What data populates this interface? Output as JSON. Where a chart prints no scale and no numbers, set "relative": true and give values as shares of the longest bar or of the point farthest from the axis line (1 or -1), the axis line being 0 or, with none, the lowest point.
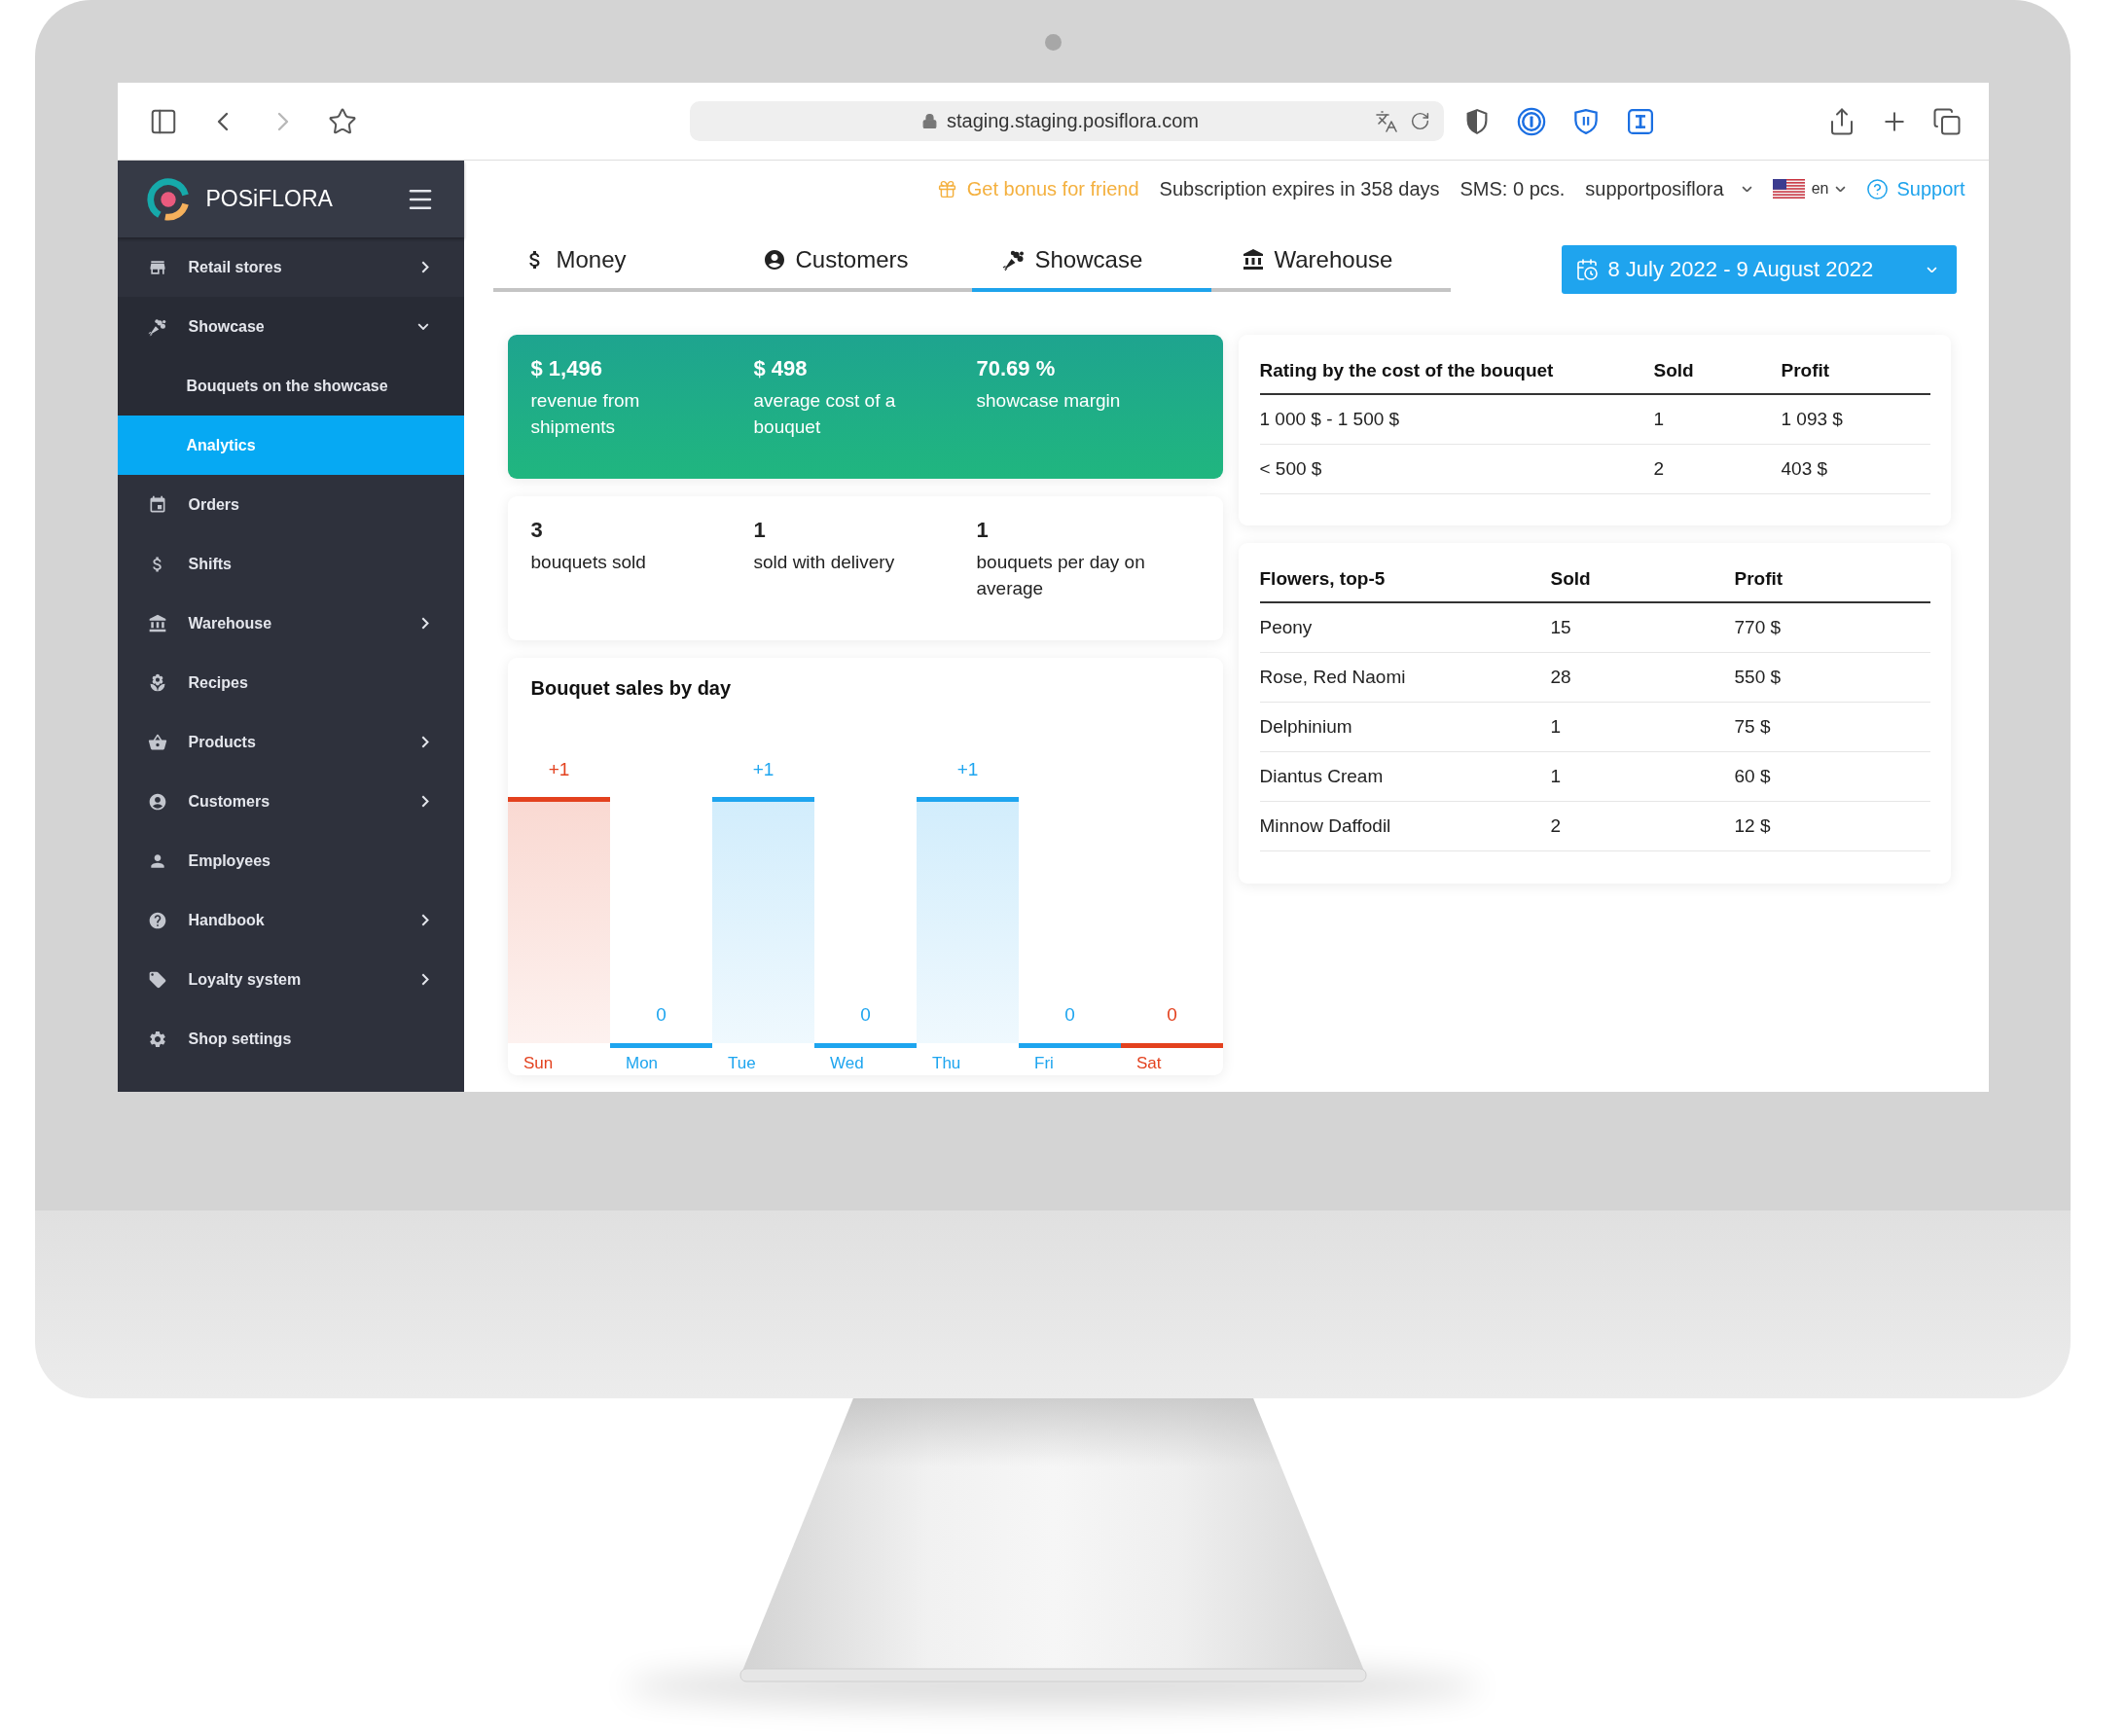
{
  "browser": {
    "url": "staging.staging.posiflora.com",
    "back": {
      "disabled": false
    },
    "forward": {
      "disabled": true
    }
  },
  "sidebar": {
    "brand": "POSiFLORA",
    "items": [
      {
        "label": "Retail stores",
        "kind": "group",
        "expanded": false,
        "selected": false
      },
      {
        "label": "Showcase",
        "kind": "group",
        "expanded": true,
        "selected": false,
        "children": [
          {
            "label": "Bouquets on the showcase",
            "selected": false
          },
          {
            "label": "Analytics",
            "selected": true
          }
        ]
      },
      {
        "label": "Orders",
        "kind": "link",
        "selected": false
      },
      {
        "label": "Shifts",
        "kind": "link",
        "selected": false
      },
      {
        "label": "Warehouse",
        "kind": "group",
        "expanded": false,
        "selected": false
      },
      {
        "label": "Recipes",
        "kind": "link",
        "selected": false
      },
      {
        "label": "Products",
        "kind": "group",
        "expanded": false,
        "selected": false
      },
      {
        "label": "Customers",
        "kind": "group",
        "expanded": false,
        "selected": false
      },
      {
        "label": "Employees",
        "kind": "link",
        "selected": false
      },
      {
        "label": "Handbook",
        "kind": "group",
        "expanded": false,
        "selected": false
      },
      {
        "label": "Loyalty system",
        "kind": "group",
        "expanded": false,
        "selected": false
      },
      {
        "label": "Shop settings",
        "kind": "link",
        "selected": false
      }
    ]
  },
  "top_bar": {
    "bonus_link": "Get bonus for friend",
    "subscription": "Subscription expires in 358 days",
    "sms": "SMS: 0 pcs.",
    "account": "supportposiflora",
    "language": "en",
    "support_link": "Support"
  },
  "tabs": [
    {
      "label": "Money",
      "selected": false
    },
    {
      "label": "Customers",
      "selected": false
    },
    {
      "label": "Showcase",
      "selected": true
    },
    {
      "label": "Warehouse",
      "selected": false
    }
  ],
  "date_range": {
    "label": "8 July 2022 - 9 August 2022"
  },
  "highlights": [
    {
      "value": "$ 1,496",
      "label": "revenue from shipments"
    },
    {
      "value": "$ 498",
      "label": "average cost of a bouquet"
    },
    {
      "value": "70.69 %",
      "label": "showcase margin"
    }
  ],
  "stats": [
    {
      "value": "3",
      "label": "bouquets sold"
    },
    {
      "value": "1",
      "label": "sold with delivery"
    },
    {
      "value": "1",
      "label": "bouquets per day on average"
    }
  ],
  "sales_chart": {
    "chart_data": {
      "type": "bar",
      "title": "Bouquet sales by day",
      "categories": [
        "Sun",
        "Mon",
        "Tue",
        "Wed",
        "Thu",
        "Fri",
        "Sat"
      ],
      "series": [
        {
          "color": "#1ea5ef",
          "values": [
            null,
            0,
            1,
            0,
            1,
            0,
            null
          ]
        },
        {
          "color": "#e3411e",
          "values": [
            1,
            null,
            null,
            null,
            null,
            null,
            0
          ]
        }
      ],
      "stacked": true,
      "relative": true,
      "value_labels": [
        "+1",
        "0",
        "+1",
        "0",
        "+1",
        "0",
        "0"
      ]
    }
  },
  "cost_rating": {
    "columns": [
      "Rating by the cost of the bouquet",
      "Sold",
      "Profit"
    ],
    "rows": [
      [
        "1 000 $ - 1 500 $",
        "1",
        "1 093 $"
      ],
      [
        "< 500 $",
        "2",
        "403 $"
      ]
    ]
  },
  "top_flowers": {
    "columns": [
      "Flowers, top-5",
      "Sold",
      "Profit"
    ],
    "rows": [
      [
        "Peony",
        "15",
        "770 $"
      ],
      [
        "Rose, Red Naomi",
        "28",
        "550 $"
      ],
      [
        "Delphinium",
        "1",
        "75 $"
      ],
      [
        "Diantus Cream",
        "1",
        "60 $"
      ],
      [
        "Minnow Daffodil",
        "2",
        "12 $"
      ]
    ]
  }
}
